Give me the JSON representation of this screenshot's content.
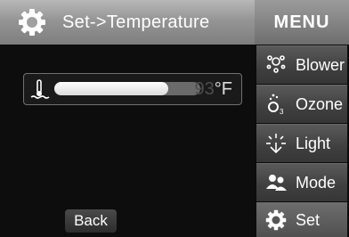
{
  "header": {
    "title": "Set->Temperature",
    "icon": "gear-icon"
  },
  "temperature": {
    "value": "93",
    "unit": "°F",
    "level": 0.78
  },
  "back_label": "Back",
  "menu": {
    "title": "MENU",
    "items": [
      {
        "label": "Blower",
        "icon": "blower-icon"
      },
      {
        "label": "Ozone",
        "icon": "ozone-icon"
      },
      {
        "label": "Light",
        "icon": "light-icon"
      },
      {
        "label": "Mode",
        "icon": "mode-icon"
      },
      {
        "label": "Set",
        "icon": "gear-icon"
      }
    ]
  }
}
